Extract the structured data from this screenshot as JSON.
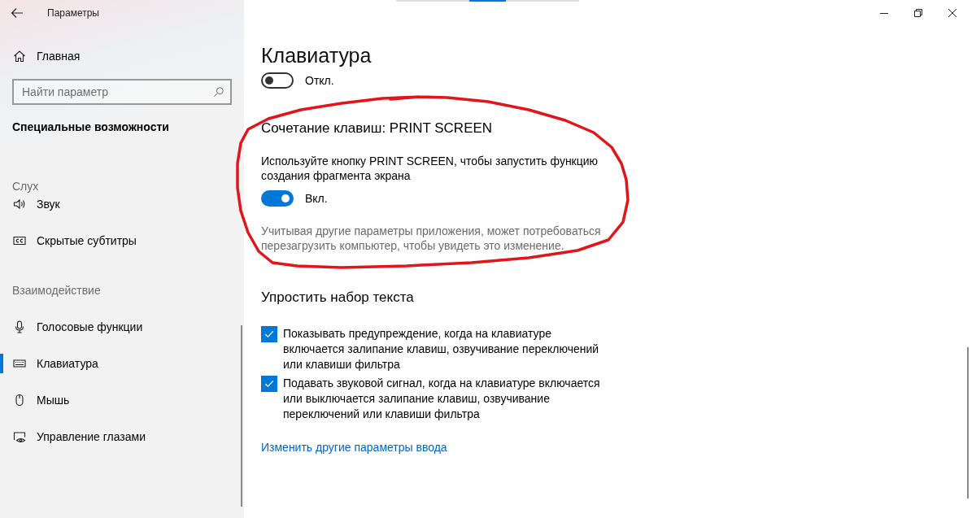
{
  "window": {
    "title": "Параметры"
  },
  "sidebar": {
    "home": {
      "label": "Главная",
      "selected": false
    },
    "search": {
      "placeholder": "Найти параметр"
    },
    "heading": "Специальные возможности",
    "groups": [
      {
        "title": "Слух",
        "items": [
          {
            "label": "Звук",
            "selected": false
          },
          {
            "label": "Скрытые субтитры",
            "selected": false
          }
        ]
      },
      {
        "title": "Взаимодействие",
        "items": [
          {
            "label": "Голосовые функции",
            "selected": false
          },
          {
            "label": "Клавиатура",
            "selected": true
          },
          {
            "label": "Мышь",
            "selected": false
          },
          {
            "label": "Управление глазами",
            "selected": false
          }
        ]
      }
    ]
  },
  "page": {
    "title": "Клавиатура",
    "toggle": {
      "on": false,
      "label": "Откл."
    },
    "sections": [
      {
        "kind": "toggle",
        "title": "Сочетание клавиш: PRINT SCREEN",
        "highlighted": true,
        "description": "Используйте кнопку PRINT SCREEN, чтобы запустить функцию создания фрагмента экрана",
        "toggle": {
          "on": true,
          "label": "Вкл."
        },
        "note": "Учитывая другие параметры приложения, может потребоваться перезагрузить компьютер, чтобы увидеть это изменение."
      },
      {
        "kind": "checkboxes",
        "title": "Упростить набор текста",
        "checkboxes": [
          {
            "label": "Показывать предупреждение, когда на клавиатуре включается залипание клавиш, озвучивание переключений или клавиши фильтра",
            "checked": true
          },
          {
            "label": "Подавать звуковой сигнал, когда на клавиатуре включается или выключается залипание клавиш, озвучивание переключений или клавиши фильтра",
            "checked": true
          }
        ],
        "link": "Изменить другие параметры ввода"
      }
    ]
  }
}
